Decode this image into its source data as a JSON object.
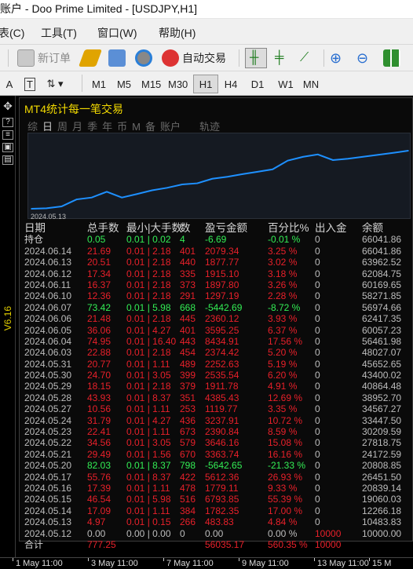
{
  "window": {
    "title": "账户 - Doo Prime Limited - [USDJPY,H1]"
  },
  "menu": [
    {
      "label": "表(C)"
    },
    {
      "label": "工具(T)"
    },
    {
      "label": "窗口(W)"
    },
    {
      "label": "帮助(H)"
    }
  ],
  "toolbar": {
    "new_order": "新订单",
    "auto_trading": "自动交易"
  },
  "timeframes": [
    "M1",
    "M5",
    "M15",
    "M30",
    "H1",
    "H4",
    "D1",
    "W1",
    "MN"
  ],
  "active_timeframe": "H1",
  "indicator_label": "V6.16",
  "panel": {
    "title": "MT4统计每一笔交易",
    "tabs": [
      "综",
      "日",
      "周",
      "月",
      "季",
      "年",
      "币",
      "M",
      "备",
      "账户",
      "",
      "轨迹"
    ],
    "active_tab": "日",
    "equity_date": "2024.05.13",
    "headers": {
      "date": "日期",
      "lots": "总手数",
      "minmax": "最小|大手数",
      "trades": "数",
      "pnl": "盈亏金额",
      "pct": "百分比%",
      "deposit": "出入金",
      "balance": "余额"
    },
    "rows": [
      {
        "date": "持仓",
        "lots": "0.05",
        "minmax": "0.01 | 0.02",
        "trades": "4",
        "pnl": "-6.69",
        "pct": "-0.01 %",
        "deposit": "0",
        "balance": "66041.86",
        "tone": "green"
      },
      {
        "date": "2024.06.14",
        "lots": "21.69",
        "minmax": "0.01 | 2.18",
        "trades": "401",
        "pnl": "2079.34",
        "pct": "3.25 %",
        "deposit": "0",
        "balance": "66041.86",
        "tone": "red"
      },
      {
        "date": "2024.06.13",
        "lots": "20.51",
        "minmax": "0.01 | 2.18",
        "trades": "440",
        "pnl": "1877.77",
        "pct": "3.02 %",
        "deposit": "0",
        "balance": "63962.52",
        "tone": "red"
      },
      {
        "date": "2024.06.12",
        "lots": "17.34",
        "minmax": "0.01 | 2.18",
        "trades": "335",
        "pnl": "1915.10",
        "pct": "3.18 %",
        "deposit": "0",
        "balance": "62084.75",
        "tone": "red"
      },
      {
        "date": "2024.06.11",
        "lots": "16.37",
        "minmax": "0.01 | 2.18",
        "trades": "373",
        "pnl": "1897.80",
        "pct": "3.26 %",
        "deposit": "0",
        "balance": "60169.65",
        "tone": "red"
      },
      {
        "date": "2024.06.10",
        "lots": "12.36",
        "minmax": "0.01 | 2.18",
        "trades": "291",
        "pnl": "1297.19",
        "pct": "2.28 %",
        "deposit": "0",
        "balance": "58271.85",
        "tone": "red"
      },
      {
        "date": "2024.06.07",
        "lots": "73.42",
        "minmax": "0.01 | 5.98",
        "trades": "668",
        "pnl": "-5442.69",
        "pct": "-8.72 %",
        "deposit": "0",
        "balance": "56974.66",
        "tone": "green"
      },
      {
        "date": "2024.06.06",
        "lots": "21.48",
        "minmax": "0.01 | 2.18",
        "trades": "445",
        "pnl": "2360.12",
        "pct": "3.93 %",
        "deposit": "0",
        "balance": "62417.35",
        "tone": "red"
      },
      {
        "date": "2024.06.05",
        "lots": "36.06",
        "minmax": "0.01 | 4.27",
        "trades": "401",
        "pnl": "3595.25",
        "pct": "6.37 %",
        "deposit": "0",
        "balance": "60057.23",
        "tone": "red"
      },
      {
        "date": "2024.06.04",
        "lots": "74.95",
        "minmax": "0.01 | 16.40",
        "trades": "443",
        "pnl": "8434.91",
        "pct": "17.56 %",
        "deposit": "0",
        "balance": "56461.98",
        "tone": "red"
      },
      {
        "date": "2024.06.03",
        "lots": "22.88",
        "minmax": "0.01 | 2.18",
        "trades": "454",
        "pnl": "2374.42",
        "pct": "5.20 %",
        "deposit": "0",
        "balance": "48027.07",
        "tone": "red"
      },
      {
        "date": "2024.05.31",
        "lots": "20.77",
        "minmax": "0.01 | 1.11",
        "trades": "489",
        "pnl": "2252.63",
        "pct": "5.19 %",
        "deposit": "0",
        "balance": "45652.65",
        "tone": "red"
      },
      {
        "date": "2024.05.30",
        "lots": "24.70",
        "minmax": "0.01 | 3.05",
        "trades": "399",
        "pnl": "2535.54",
        "pct": "6.20 %",
        "deposit": "0",
        "balance": "43400.02",
        "tone": "red"
      },
      {
        "date": "2024.05.29",
        "lots": "18.15",
        "minmax": "0.01 | 2.18",
        "trades": "379",
        "pnl": "1911.78",
        "pct": "4.91 %",
        "deposit": "0",
        "balance": "40864.48",
        "tone": "red"
      },
      {
        "date": "2024.05.28",
        "lots": "43.93",
        "minmax": "0.01 | 8.37",
        "trades": "351",
        "pnl": "4385.43",
        "pct": "12.69 %",
        "deposit": "0",
        "balance": "38952.70",
        "tone": "red"
      },
      {
        "date": "2024.05.27",
        "lots": "10.56",
        "minmax": "0.01 | 1.11",
        "trades": "253",
        "pnl": "1119.77",
        "pct": "3.35 %",
        "deposit": "0",
        "balance": "34567.27",
        "tone": "red"
      },
      {
        "date": "2024.05.24",
        "lots": "31.79",
        "minmax": "0.01 | 4.27",
        "trades": "436",
        "pnl": "3237.91",
        "pct": "10.72 %",
        "deposit": "0",
        "balance": "33447.50",
        "tone": "red"
      },
      {
        "date": "2024.05.23",
        "lots": "22.41",
        "minmax": "0.01 | 1.11",
        "trades": "673",
        "pnl": "2390.84",
        "pct": "8.59 %",
        "deposit": "0",
        "balance": "30209.59",
        "tone": "red"
      },
      {
        "date": "2024.05.22",
        "lots": "34.56",
        "minmax": "0.01 | 3.05",
        "trades": "579",
        "pnl": "3646.16",
        "pct": "15.08 %",
        "deposit": "0",
        "balance": "27818.75",
        "tone": "red"
      },
      {
        "date": "2024.05.21",
        "lots": "29.49",
        "minmax": "0.01 | 1.56",
        "trades": "670",
        "pnl": "3363.74",
        "pct": "16.16 %",
        "deposit": "0",
        "balance": "24172.59",
        "tone": "red"
      },
      {
        "date": "2024.05.20",
        "lots": "82.03",
        "minmax": "0.01 | 8.37",
        "trades": "798",
        "pnl": "-5642.65",
        "pct": "-21.33 %",
        "deposit": "0",
        "balance": "20808.85",
        "tone": "green"
      },
      {
        "date": "2024.05.17",
        "lots": "55.76",
        "minmax": "0.01 | 8.37",
        "trades": "422",
        "pnl": "5612.36",
        "pct": "26.93 %",
        "deposit": "0",
        "balance": "26451.50",
        "tone": "red"
      },
      {
        "date": "2024.05.16",
        "lots": "17.39",
        "minmax": "0.01 | 1.11",
        "trades": "478",
        "pnl": "1779.11",
        "pct": "9.33 %",
        "deposit": "0",
        "balance": "20839.14",
        "tone": "red"
      },
      {
        "date": "2024.05.15",
        "lots": "46.54",
        "minmax": "0.01 | 5.98",
        "trades": "516",
        "pnl": "6793.85",
        "pct": "55.39 %",
        "deposit": "0",
        "balance": "19060.03",
        "tone": "red"
      },
      {
        "date": "2024.05.14",
        "lots": "17.09",
        "minmax": "0.01 | 1.11",
        "trades": "384",
        "pnl": "1782.35",
        "pct": "17.00 %",
        "deposit": "0",
        "balance": "12266.18",
        "tone": "red"
      },
      {
        "date": "2024.05.13",
        "lots": "4.97",
        "minmax": "0.01 | 0.15",
        "trades": "266",
        "pnl": "483.83",
        "pct": "4.84 %",
        "deposit": "0",
        "balance": "10483.83",
        "tone": "red"
      },
      {
        "date": "2024.05.12",
        "lots": "0.00",
        "minmax": "0.00 | 0.00",
        "trades": "0",
        "pnl": "0.00",
        "pct": "0.00 %",
        "deposit": "10000",
        "balance": "10000.00",
        "tone": "gray"
      }
    ],
    "total": {
      "label": "合计",
      "lots": "777.25",
      "pnl": "56035.17",
      "pct": "560.35 %",
      "deposit": "10000"
    }
  },
  "time_axis": [
    "1 May 11:00",
    "3 May 11:00",
    "7 May 11:00",
    "9 May 11:00",
    "13 May 11:00",
    "15 M"
  ],
  "colors": {
    "profit": "#e8202a",
    "loss": "#33ee55",
    "title": "#f2d900",
    "equity_line": "#1e90ff"
  },
  "chart_data": {
    "type": "line",
    "series": [
      {
        "values": [
          10000,
          10483.83,
          12266.18,
          19060.03,
          20839.14,
          26451.5,
          20808.85,
          24172.59,
          27818.75,
          30209.59,
          33447.5,
          34567.27,
          38952.7,
          40864.48,
          43400.02,
          45652.65,
          48027.07,
          56461.98,
          60057.23,
          62417.35,
          56974.66,
          58271.85,
          60169.65,
          62084.75,
          63962.52,
          66041.86
        ]
      }
    ]
  }
}
